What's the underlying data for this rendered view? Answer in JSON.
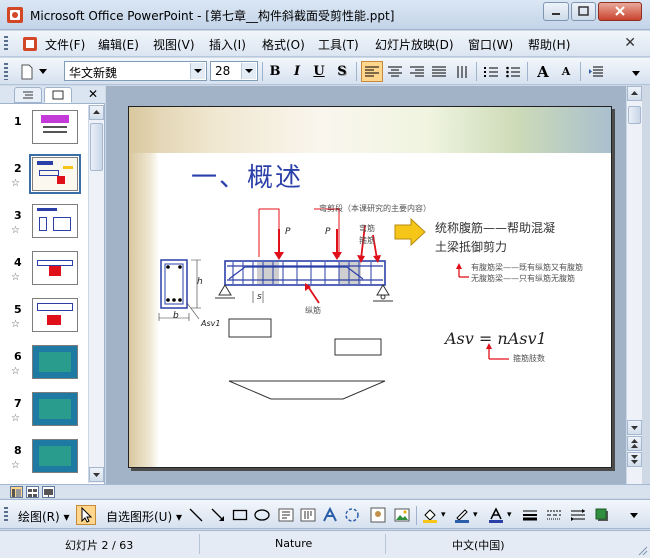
{
  "window": {
    "title": "Microsoft Office PowerPoint - [第七章__构件斜截面受剪性能.ppt]"
  },
  "menu": {
    "items": [
      "文件(F)",
      "编辑(E)",
      "视图(V)",
      "插入(I)",
      "格式(O)",
      "工具(T)",
      "幻灯片放映(D)",
      "窗口(W)",
      "帮助(H)"
    ]
  },
  "format_toolbar": {
    "font_name": "华文新魏",
    "font_size": "28",
    "bold_label": "B",
    "italic_label": "I",
    "underline_label": "U",
    "shadow_label": "S",
    "grow_label": "A",
    "shrink_label": "A"
  },
  "slides_pane": {
    "slides": [
      {
        "num": "1",
        "has_anim": false
      },
      {
        "num": "2",
        "has_anim": true,
        "selected": true
      },
      {
        "num": "3",
        "has_anim": true
      },
      {
        "num": "4",
        "has_anim": true
      },
      {
        "num": "5",
        "has_anim": true
      },
      {
        "num": "6",
        "has_anim": true
      },
      {
        "num": "7",
        "has_anim": true
      },
      {
        "num": "8",
        "has_anim": true
      }
    ],
    "anim_glyph": "☆"
  },
  "slide": {
    "title": "一、概述",
    "callout_shear_zone": "弯剪段（本课研究的主要内容）",
    "label_P1": "P",
    "label_P2": "P",
    "label_stirrup": "箍筋",
    "label_bent": "弯筋",
    "label_longitudinal": "纵筋",
    "label_h": "h",
    "label_b": "b",
    "label_s": "s",
    "label_Asv1": "Asv1",
    "note_line1": "统称腹筋——帮助混凝",
    "note_line2": "土梁抵御剪力",
    "web_rebar_line1": "有腹筋梁——既有纵筋又有腹筋",
    "web_rebar_line2": "无腹筋梁——只有纵筋无腹筋",
    "formula": "Asv = nAsv1",
    "stirrup_legs": "箍筋肢数"
  },
  "draw_toolbar": {
    "draw_label": "绘图(R)",
    "autoshape_label": "自选图形(U)"
  },
  "status": {
    "slide_pos": "幻灯片 2 / 63",
    "design": "Nature",
    "language": "中文(中国)"
  },
  "colors": {
    "title_blue": "#2b3fa8",
    "arrow_red": "#e0101a",
    "beam_blue": "#2b3fa8",
    "highlight_yellow": "#f5c518"
  }
}
